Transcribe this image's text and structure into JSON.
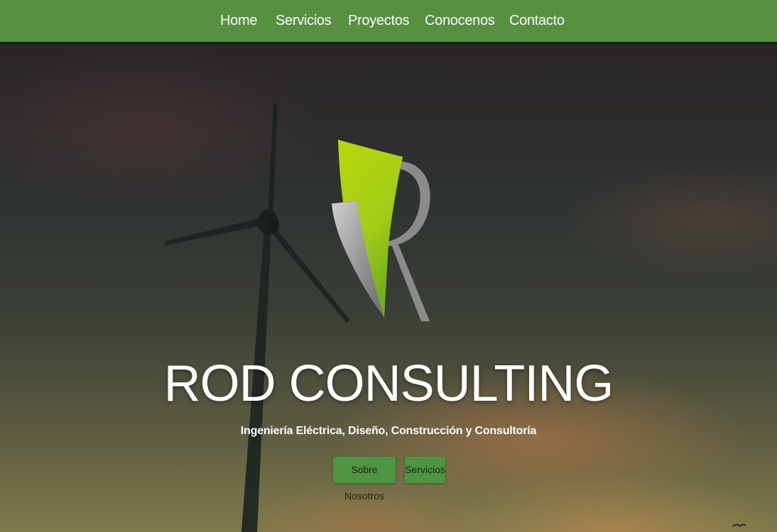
{
  "nav": {
    "items": [
      {
        "label": "Home"
      },
      {
        "label": "Servicios"
      },
      {
        "label": "Proyectos"
      },
      {
        "label": "Conocenos"
      },
      {
        "label": "Contacto"
      }
    ]
  },
  "hero": {
    "title": "ROD CONSULTING",
    "subtitle": "Ingeniería Eléctrica, Diseño, Construcción y Consultoría",
    "buttons": [
      {
        "label": "Sobre Nosotros"
      },
      {
        "label": "Servicios"
      }
    ],
    "logo_icon": "rod-consulting-logo",
    "background_image": "wind-turbine-sunset"
  },
  "colors": {
    "nav_bg": "#55913f",
    "button_bg": "#4d9443",
    "logo_green": "#a8cf12",
    "logo_gray": "#8f8f8f"
  }
}
